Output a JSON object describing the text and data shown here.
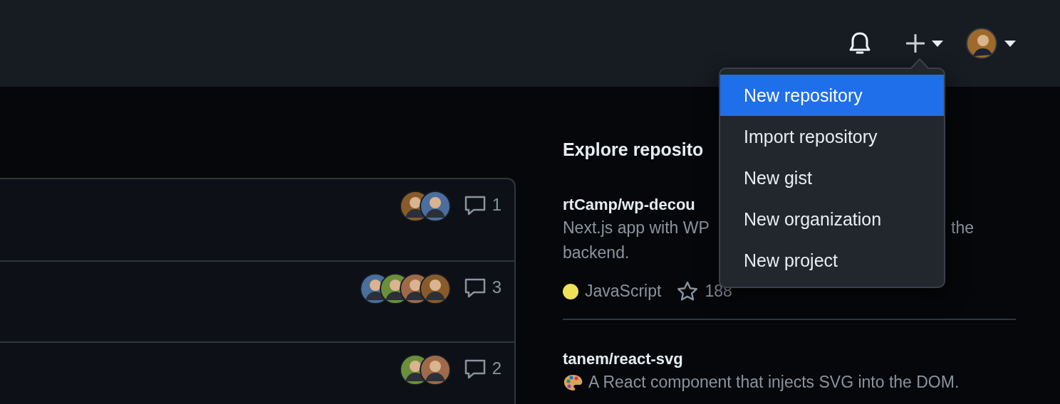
{
  "header": {
    "new_menu": {
      "expanded": true,
      "items": [
        {
          "label": "New repository",
          "selected": true
        },
        {
          "label": "Import repository",
          "selected": false
        },
        {
          "label": "New gist",
          "selected": false
        },
        {
          "label": "New organization",
          "selected": false
        },
        {
          "label": "New project",
          "selected": false
        }
      ]
    }
  },
  "discussions": [
    {
      "participants": [
        {
          "kind": "avatar"
        },
        {
          "kind": "avatar"
        }
      ],
      "comments": "1"
    },
    {
      "participants": [
        {
          "kind": "avatar"
        },
        {
          "kind": "avatar"
        },
        {
          "kind": "avatar"
        },
        {
          "kind": "avatar"
        }
      ],
      "comments": "3"
    },
    {
      "participants": [
        {
          "kind": "avatar"
        },
        {
          "kind": "avatar"
        }
      ],
      "comments": "2"
    }
  ],
  "explore": {
    "title": "Explore reposito",
    "repos": [
      {
        "name": "rtCamp/wp-decou",
        "description": {
          "start": "Next.js app with WP",
          "end": "the",
          "continuation": "backend."
        },
        "language": "JavaScript",
        "color": "#f1e05a",
        "stars": "188"
      },
      {
        "name": "tanem/react-svg",
        "description": {
          "start": "A React component that injects SVG into the DOM."
        },
        "emoji": true
      }
    ]
  }
}
